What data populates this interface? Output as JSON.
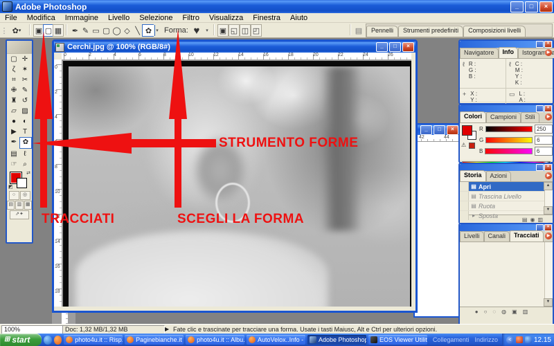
{
  "window": {
    "title": "Adobe Photoshop"
  },
  "menu": {
    "items": [
      "File",
      "Modifica",
      "Immagine",
      "Livello",
      "Selezione",
      "Filtro",
      "Visualizza",
      "Finestra",
      "Aiuto"
    ]
  },
  "icons": {
    "minimize": "_",
    "maximize": "□",
    "close": "×",
    "dropdown": "▾",
    "play": "▶",
    "panel_menu": "▶",
    "heart": "♥",
    "warning": "⚠",
    "scroll_up": "▲",
    "scroll_down": "▼",
    "chevron_left": "<",
    "win_flag": "⊞",
    "grip": "⋮"
  },
  "options_bar": {
    "tool_preset_glyph": "✿",
    "mode_buttons": [
      {
        "name": "shape-layers-mode",
        "glyph": "▣"
      },
      {
        "name": "paths-mode",
        "glyph": "▢"
      },
      {
        "name": "fill-pixels-mode",
        "glyph": "▦"
      }
    ],
    "shape_tools": [
      {
        "name": "pen-tool",
        "glyph": "✒"
      },
      {
        "name": "freeform-pen-tool",
        "glyph": "✎"
      },
      {
        "name": "rectangle-tool",
        "glyph": "▭"
      },
      {
        "name": "rounded-rectangle-tool",
        "glyph": "▢"
      },
      {
        "name": "ellipse-tool",
        "glyph": "◯"
      },
      {
        "name": "polygon-tool",
        "glyph": "◇"
      },
      {
        "name": "line-tool",
        "glyph": "╲"
      },
      {
        "name": "custom-shape-tool",
        "glyph": "✿"
      }
    ],
    "forma_label": "Forma:",
    "shape_preview": "♥",
    "geometry_buttons": [
      {
        "name": "add-shape-area",
        "glyph": "▣"
      },
      {
        "name": "subtract-shape-area",
        "glyph": "◱"
      },
      {
        "name": "intersect-shape-area",
        "glyph": "◫"
      },
      {
        "name": "exclude-shape-area",
        "glyph": "◰"
      }
    ],
    "well_tabs": [
      "Pennelli",
      "Strumenti predefiniti",
      "Composizioni livelli"
    ]
  },
  "toolbox": {
    "tools": [
      {
        "name": "rectangular-marquee",
        "glyph": "▢"
      },
      {
        "name": "move",
        "glyph": "✛"
      },
      {
        "name": "lasso",
        "glyph": "ζ"
      },
      {
        "name": "magic-wand",
        "glyph": "✶"
      },
      {
        "name": "crop",
        "glyph": "⌗"
      },
      {
        "name": "slice",
        "glyph": "✂"
      },
      {
        "name": "healing-brush",
        "glyph": "✙"
      },
      {
        "name": "brush",
        "glyph": "✎"
      },
      {
        "name": "clone-stamp",
        "glyph": "♜"
      },
      {
        "name": "history-brush",
        "glyph": "↺"
      },
      {
        "name": "eraser",
        "glyph": "▱"
      },
      {
        "name": "gradient",
        "glyph": "▨"
      },
      {
        "name": "blur",
        "glyph": "●"
      },
      {
        "name": "dodge",
        "glyph": "◐"
      },
      {
        "name": "path-selection",
        "glyph": "▶"
      },
      {
        "name": "type",
        "glyph": "T"
      },
      {
        "name": "pen",
        "glyph": "✒"
      },
      {
        "name": "custom-shape",
        "glyph": "✿"
      },
      {
        "name": "notes",
        "glyph": "▤"
      },
      {
        "name": "eyedropper",
        "glyph": "ℓ"
      },
      {
        "name": "hand",
        "glyph": "☞"
      },
      {
        "name": "zoom",
        "glyph": "⌕"
      }
    ],
    "foreground_color": "#e00000",
    "background_color": "#ffffff"
  },
  "document": {
    "title": "Cerchi.jpg @ 100% (RGB/8#)",
    "ruler_h": [
      "0",
      "2",
      "4",
      "6",
      "8",
      "10",
      "12",
      "14",
      "16",
      "18",
      "20",
      "22",
      "24",
      "26"
    ],
    "ruler_v": [
      "0",
      "2",
      "4",
      "6",
      "8",
      "10",
      "12",
      "14",
      "16",
      "18"
    ],
    "bg_ruler": [
      "42",
      "44"
    ]
  },
  "annotations": {
    "color": "#ee1111",
    "strumento_forme": "STRUMENTO FORME",
    "tracciati": "TRACCIATI",
    "scegli_la_forma": "SCEGLI LA FORMA"
  },
  "panels": {
    "navigator": {
      "tabs": [
        "Navigatore",
        "Info",
        "Istogramma"
      ],
      "active_tab": "Info",
      "info": {
        "rgb": [
          "R :",
          "G :",
          "B :"
        ],
        "cmyk": [
          "C :",
          "M :",
          "Y :",
          "K :"
        ],
        "xy": [
          "X :",
          "Y :"
        ],
        "wh": [
          "L :",
          "A :"
        ]
      }
    },
    "colori": {
      "tabs": [
        "Colori",
        "Campioni",
        "Stili"
      ],
      "active_tab": "Colori",
      "sliders": [
        {
          "label": "R",
          "value": "250"
        },
        {
          "label": "G",
          "value": "6"
        },
        {
          "label": "B",
          "value": "6"
        }
      ]
    },
    "storia": {
      "tabs": [
        "Storia",
        "Azioni"
      ],
      "active_tab": "Storia",
      "items": [
        {
          "label": "Apri",
          "state": "selected"
        },
        {
          "label": "Trascina Livello",
          "state": "disabled"
        },
        {
          "label": "Ruota",
          "state": "disabled"
        },
        {
          "label": "Sposta",
          "state": "disabled"
        }
      ],
      "footer_buttons": [
        {
          "name": "new-document-from-state",
          "glyph": "▤"
        },
        {
          "name": "new-snapshot",
          "glyph": "◉"
        },
        {
          "name": "delete-state",
          "glyph": "▥"
        }
      ]
    },
    "livelli": {
      "tabs": [
        "Livelli",
        "Canali",
        "Tracciati"
      ],
      "active_tab": "Tracciati",
      "footer_buttons": [
        {
          "name": "fill-path",
          "glyph": "●"
        },
        {
          "name": "stroke-path",
          "glyph": "○"
        },
        {
          "name": "load-path-as-selection",
          "glyph": "◌"
        },
        {
          "name": "make-work-path",
          "glyph": "◍"
        },
        {
          "name": "new-path",
          "glyph": "▣"
        },
        {
          "name": "delete-path",
          "glyph": "▥"
        }
      ]
    }
  },
  "status_bar": {
    "zoom": "100%",
    "doc": "Doc: 1,32 MB/1,32 MB",
    "tip": "Fate clic e trascinate per tracciare una forma. Usate i tasti Maiusc, Alt e Ctrl per ulteriori opzioni."
  },
  "taskbar": {
    "start": "start",
    "buttons": [
      {
        "label": "photo4u.it :: Risp...",
        "icon": "firefox"
      },
      {
        "label": "Paginebianche.it |...",
        "icon": "firefox"
      },
      {
        "label": "photo4u.it :: Albu...",
        "icon": "firefox"
      },
      {
        "label": "AutoVelox..Info - ...",
        "icon": "firefox"
      },
      {
        "label": "Adobe Photoshop",
        "icon": "photoshop",
        "active": true
      },
      {
        "label": "EOS Viewer Utility ...",
        "icon": "eos"
      }
    ],
    "toolbars": [
      "Collegamenti",
      "Indirizzo"
    ],
    "time": "12.15"
  }
}
